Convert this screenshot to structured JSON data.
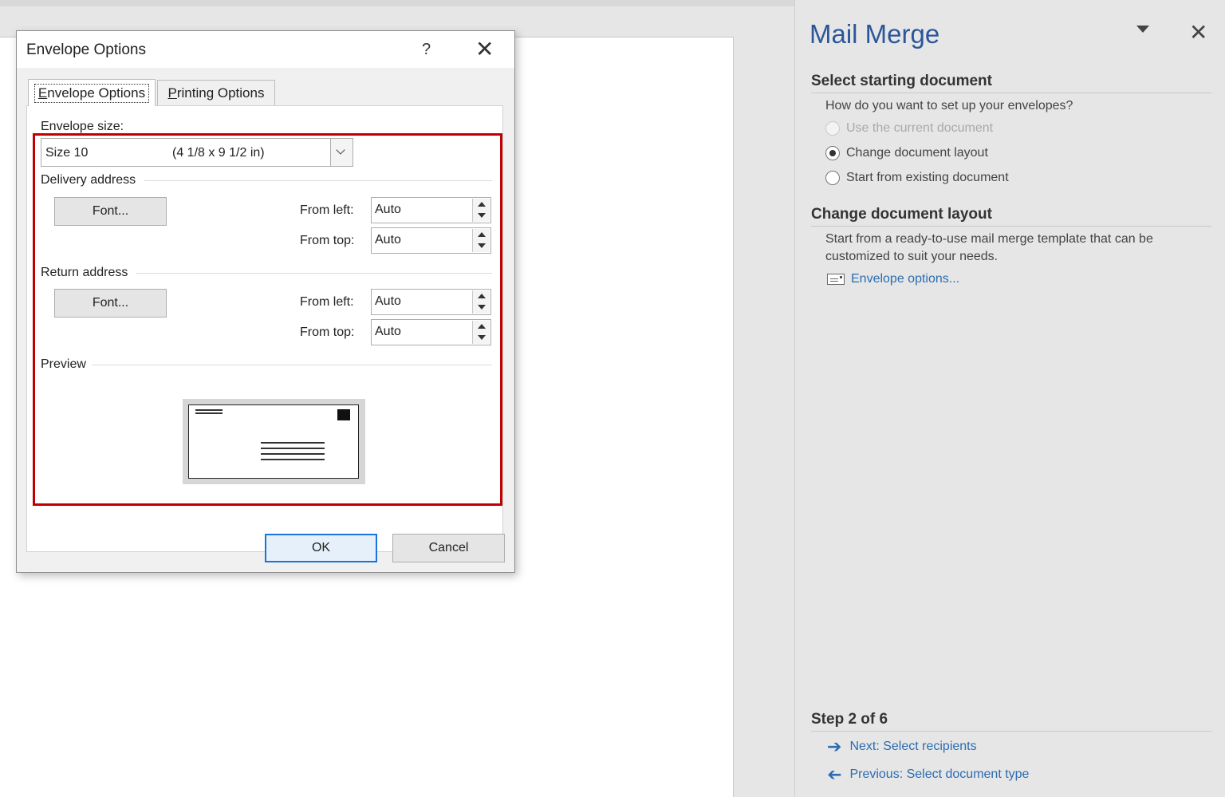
{
  "pane": {
    "title": "Mail Merge",
    "section1_heading": "Select starting document",
    "question": "How do you want to set up your envelopes?",
    "options": [
      {
        "label": "Use the current document",
        "state": "disabled"
      },
      {
        "label": "Change document layout",
        "state": "checked"
      },
      {
        "label": "Start from existing document",
        "state": "unchecked"
      }
    ],
    "section2_heading": "Change document layout",
    "description_line1": "Start from a ready-to-use mail merge template that can be",
    "description_line2": "customized to suit your needs.",
    "envelope_link": "Envelope options...",
    "step_heading": "Step 2 of 6",
    "next_link": "Next: Select recipients",
    "prev_link": "Previous: Select document type"
  },
  "dialog": {
    "title": "Envelope Options",
    "help": "?",
    "close": "✕",
    "tabs": [
      {
        "label": "Envelope Options",
        "mnemonic": "E",
        "rest": "nvelope Options",
        "active": true
      },
      {
        "label": "Printing Options",
        "mnemonic": "P",
        "rest": "rinting Options",
        "active": false
      }
    ],
    "envelope_size_label": "Envelope size:",
    "envelope_size_value": "Size 10",
    "envelope_size_dims": "(4 1/8 x 9 1/2 in)",
    "delivery_group": "Delivery address",
    "return_group": "Return address",
    "preview_group": "Preview",
    "font_button": "Font...",
    "from_left_label": "From left:",
    "from_top_label": "From top:",
    "delivery_from_left": "Auto",
    "delivery_from_top": "Auto",
    "return_from_left": "Auto",
    "return_from_top": "Auto",
    "ok_button": "OK",
    "cancel_button": "Cancel"
  },
  "colors": {
    "accent_blue": "#2b579a",
    "link_blue": "#2b6cb0",
    "highlight_red": "#c00000",
    "default_button_border": "#1a73d9"
  }
}
